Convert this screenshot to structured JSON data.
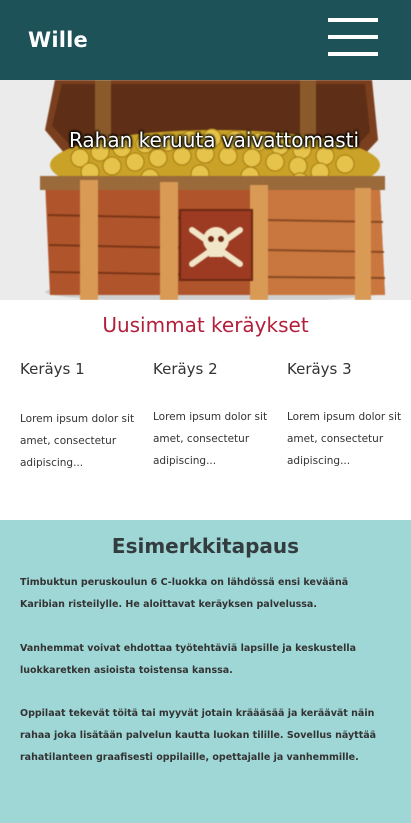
{
  "header": {
    "brand": "Wille",
    "menu_icon": "hamburger-menu-icon"
  },
  "hero": {
    "title": "Rahan keruuta vaivattomasti",
    "image": "treasure-chest-image"
  },
  "latest": {
    "title": "Uusimmat keräykset",
    "items": [
      {
        "title": "Keräys 1",
        "text": "Lorem ipsum dolor sit amet, consectetur adipiscing..."
      },
      {
        "title": "Keräys 2",
        "text": "Lorem ipsum dolor sit amet, consectetur adipiscing..."
      },
      {
        "title": "Keräys 3",
        "text": "Lorem ipsum dolor sit amet, consectetur adipiscing..."
      }
    ]
  },
  "example": {
    "title": "Esimerkkitapaus",
    "paragraphs": [
      "Timbuktun peruskoulun 6 C-luokka on lähdössä ensi keväänä Karibian risteilylle. He aloittavat keräyksen palvelussa.",
      "Vanhemmat voivat ehdottaa työtehtäviä lapsille ja keskustella luokkaretken asioista toistensa kanssa.",
      "Oppilaat tekevät töitä tai myyvät jotain kräääsää ja keräävät näin rahaa joka lisätään palvelun kautta luokan tilille. Sovellus näyttää rahatilanteen graafisesti oppilaille, opettajalle ja vanhemmille."
    ]
  },
  "colors": {
    "header_bg": "#1c5258",
    "accent": "#b31f3b",
    "example_bg": "#9fd7d6"
  }
}
